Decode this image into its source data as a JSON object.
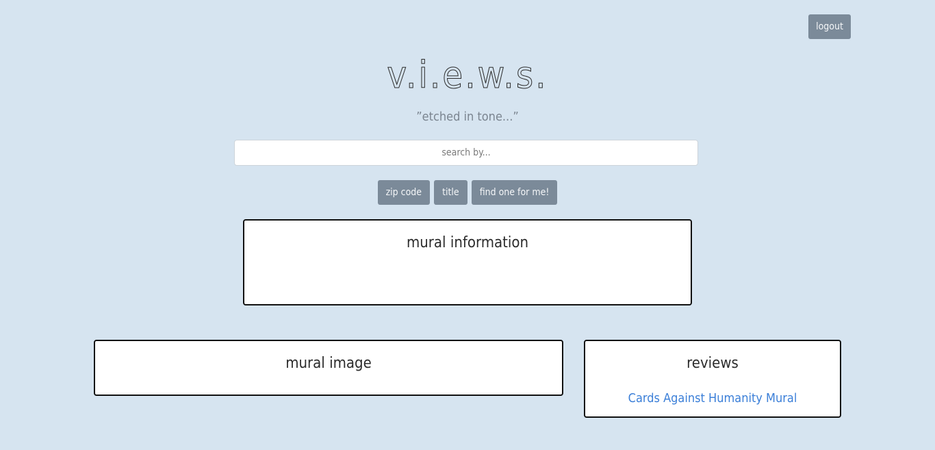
{
  "header": {
    "logout_label": "logout",
    "brand": "v.i.e.w.s.",
    "tagline": "”etched in tone...”"
  },
  "search": {
    "placeholder": "search by...",
    "value": ""
  },
  "filters": {
    "zip_label": "zip code",
    "title_label": "title",
    "random_label": "find one for me!"
  },
  "panels": {
    "info_title": "mural information",
    "image_title": "mural image",
    "reviews_title": "reviews"
  },
  "reviews": {
    "items": [
      "Cards Against Humanity Mural"
    ]
  },
  "colors": {
    "background": "#d6e4f0",
    "button": "#7b8a99",
    "link": "#3b7fd8"
  }
}
